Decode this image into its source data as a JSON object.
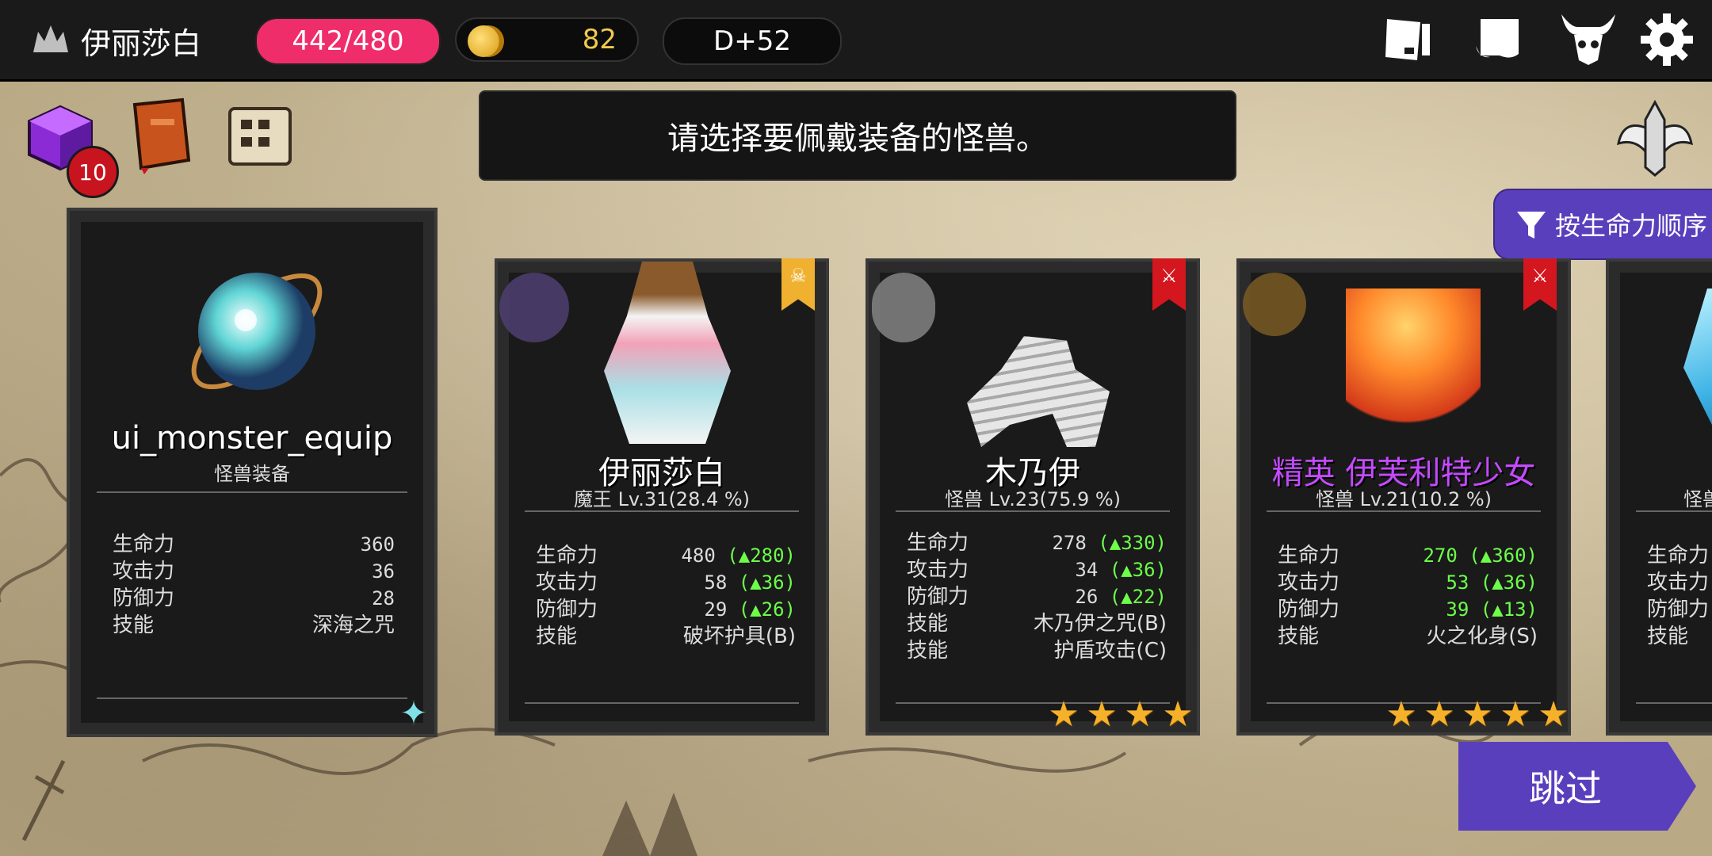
{
  "topbar": {
    "player_name": "伊丽莎白",
    "hp": "442/480",
    "gold": "82",
    "day": "D+52",
    "icons": [
      "book-icon",
      "scroll-icon",
      "demon-horns-icon",
      "gear-icon"
    ]
  },
  "toolbar": {
    "chest_badge": "10",
    "icons": [
      "cube-chest-icon",
      "red-book-icon",
      "map-scroll-icon",
      "winged-helmet-icon"
    ]
  },
  "banner": {
    "text": "请选择要佩戴装备的怪兽。"
  },
  "sort_button": {
    "label": "按生命力顺序"
  },
  "skip_button": {
    "label": "跳过"
  },
  "equip_card": {
    "name": "ui_monster_equip",
    "subtitle": "怪兽装备",
    "stats": [
      {
        "label": "生命力",
        "value": "360"
      },
      {
        "label": "攻击力",
        "value": "36"
      },
      {
        "label": "防御力",
        "value": "28"
      },
      {
        "label": "技能",
        "value": "深海之咒"
      }
    ]
  },
  "monsters": [
    {
      "name": "伊丽莎白",
      "type": "魔王 Lv.31(28.4 %)",
      "ribbon_color": "#f0b030",
      "stats": [
        {
          "label": "生命力",
          "value": "480",
          "delta": "(▲280)"
        },
        {
          "label": "攻击力",
          "value": "58",
          "delta": "(▲36)"
        },
        {
          "label": "防御力",
          "value": "29",
          "delta": "(▲26)"
        },
        {
          "label": "技能",
          "value": "破坏护具(B)",
          "delta": ""
        }
      ],
      "stars": 0
    },
    {
      "name": "木乃伊",
      "type": "怪兽 Lv.23(75.9 %)",
      "ribbon_color": "#d4161f",
      "stats": [
        {
          "label": "生命力",
          "value": "278",
          "delta": "(▲330)"
        },
        {
          "label": "攻击力",
          "value": "34",
          "delta": "(▲36)"
        },
        {
          "label": "防御力",
          "value": "26",
          "delta": "(▲22)"
        },
        {
          "label": "技能",
          "value": "木乃伊之咒(B)",
          "delta": ""
        },
        {
          "label": "技能",
          "value": "护盾攻击(C)",
          "delta": ""
        }
      ],
      "stars": 4
    },
    {
      "name": "精英 伊芙利特少女",
      "type": "怪兽 Lv.21(10.2 %)",
      "ribbon_color": "#d4161f",
      "stats": [
        {
          "label": "生命力",
          "value": "270",
          "delta": "(▲360)"
        },
        {
          "label": "攻击力",
          "value": "53",
          "delta": "(▲36)"
        },
        {
          "label": "防御力",
          "value": "39",
          "delta": "(▲13)"
        },
        {
          "label": "技能",
          "value": "火之化身(S)",
          "delta": ""
        }
      ],
      "stars": 5
    },
    {
      "name": "",
      "type": "怪兽",
      "stats": [
        {
          "label": "生命力"
        },
        {
          "label": "攻击力"
        },
        {
          "label": "防御力"
        },
        {
          "label": "技能"
        }
      ]
    }
  ]
}
